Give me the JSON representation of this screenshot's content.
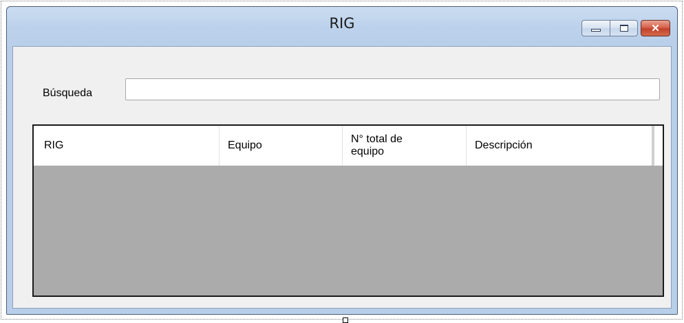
{
  "window": {
    "title": "RIG",
    "minimize_symbol": "",
    "maximize_symbol": "",
    "close_symbol": "✕"
  },
  "search": {
    "label": "Búsqueda",
    "value": "",
    "placeholder": ""
  },
  "grid": {
    "columns": [
      "RIG",
      "Equipo",
      "N° total de equipo",
      "Descripción"
    ],
    "rows": []
  },
  "colors": {
    "title_bar": "#bcd2ec",
    "client_background": "#f0f0f0",
    "grid_background": "#ababab",
    "close_button": "#c2412b"
  },
  "icons": [
    "minimize-icon",
    "maximize-icon",
    "close-icon"
  ]
}
